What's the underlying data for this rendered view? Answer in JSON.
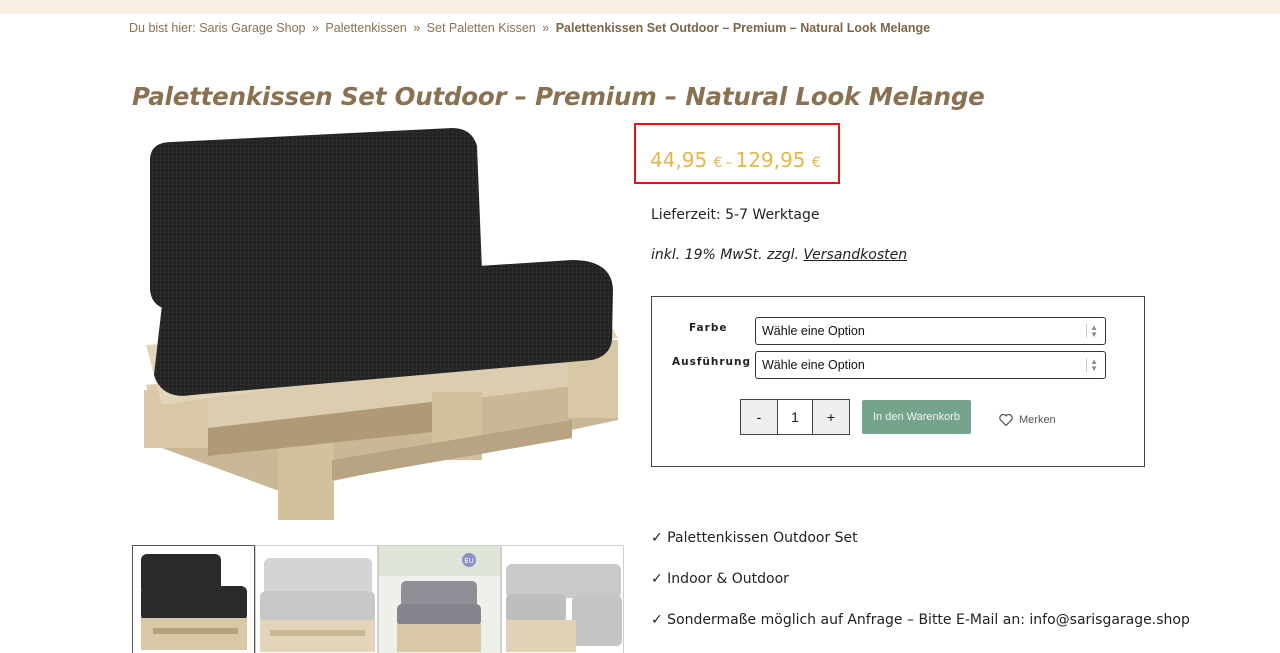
{
  "breadcrumb": {
    "prefix": "Du bist hier:",
    "items": [
      "Saris Garage Shop",
      "Palettenkissen",
      "Set Paletten Kissen"
    ],
    "separator": "»",
    "current": "Palettenkissen Set Outdoor – Premium – Natural Look Melange"
  },
  "product": {
    "title": "Palettenkissen Set Outdoor – Premium – Natural Look Melange",
    "price_min": "44,95",
    "price_max": "129,95",
    "currency": "€",
    "price_dash": "–",
    "delivery": "Lieferzeit: 5-7 Werktage",
    "tax_prefix": "inkl. 19% MwSt. zzgl.",
    "shipping_link": "Versandkosten",
    "colors": {
      "price": "#e5b64a",
      "highlight_border": "#e0141b",
      "title": "#8a7152",
      "cart_button": "#75a48c"
    }
  },
  "options": {
    "color_label": "Farbe",
    "color_value": "Wähle eine Option",
    "variant_label": "Ausführung",
    "variant_value": "Wähle eine Option"
  },
  "cart": {
    "minus": "-",
    "quantity": "1",
    "plus": "+",
    "add_to_cart": "In den Warenkorb",
    "wishlist": "Merken"
  },
  "features": [
    "✓ Palettenkissen Outdoor Set",
    "✓ Indoor & Outdoor",
    "✓ Sondermaße möglich auf Anfrage – Bitte E-Mail an: info@sarisgarage.shop"
  ],
  "gallery": {
    "thumbnails": [
      "black-pallet-sofa",
      "grey-pallet-sofa",
      "grey-pallet-sofa-outdoor",
      "grey-pallet-corner-sofa"
    ],
    "badge": "EU"
  }
}
